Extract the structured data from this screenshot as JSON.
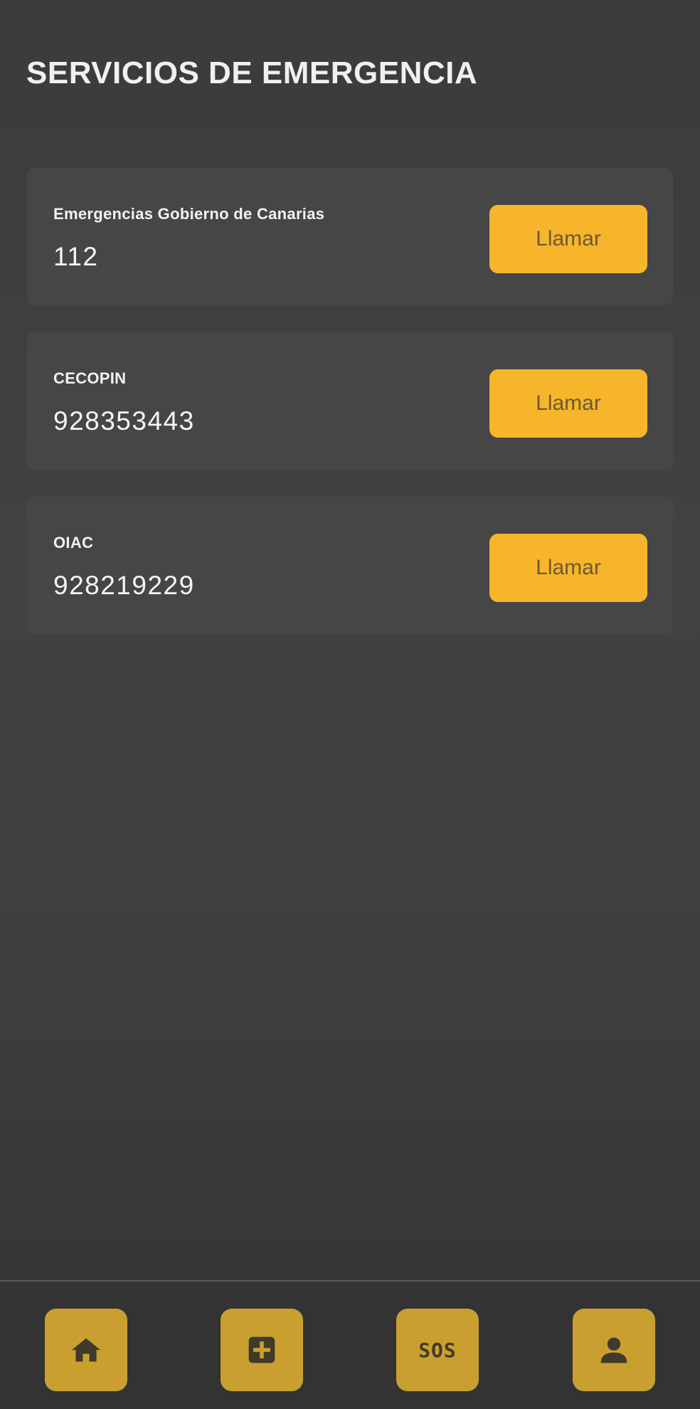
{
  "header": {
    "title": "SERVICIOS DE EMERGENCIA"
  },
  "services": [
    {
      "name": "Emergencias Gobierno de Canarias",
      "phone": "112",
      "button_label": "Llamar"
    },
    {
      "name": "CECOPIN",
      "phone": "928353443",
      "button_label": "Llamar"
    },
    {
      "name": "OIAC",
      "phone": "928219229",
      "button_label": "Llamar"
    }
  ],
  "bottom_nav": {
    "items": [
      {
        "icon": "home-icon"
      },
      {
        "icon": "plus-square-icon"
      },
      {
        "icon": "sos-icon",
        "label": "SOS"
      },
      {
        "icon": "person-icon"
      }
    ]
  },
  "colors": {
    "accent": "#f7b52c",
    "nav_button": "#c9a030",
    "background": "#3e3e3e",
    "card": "#464646"
  }
}
